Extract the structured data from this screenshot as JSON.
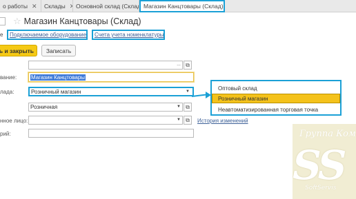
{
  "tabs": [
    {
      "label": "о работы"
    },
    {
      "label": "Склады"
    },
    {
      "label": "Основной склад (Склад)"
    },
    {
      "label": "Магазин Канцтовары (Склад)"
    }
  ],
  "header": {
    "title": "Магазин Канцтовары (Склад)"
  },
  "links": {
    "cut_label": "е",
    "equipment": "Подключаемое оборудование",
    "accounts": "Счета учета номенклатуры"
  },
  "toolbar": {
    "save_close": "ть и закрыть",
    "save": "Записать"
  },
  "form": {
    "name_label": "вание:",
    "name_value": "Магазин Канцтовары",
    "type_label": "лада:",
    "type_value": "Розничный магазин",
    "price_type_value": "Розничная",
    "responsible_label": "нное лицо:",
    "comment_label": "рий:",
    "history_link": "История изменений"
  },
  "dropdown": {
    "options": [
      {
        "label": "Оптовый склад"
      },
      {
        "label": "Розничный магазин"
      },
      {
        "label": "Неавтоматизированная торговая точка"
      }
    ],
    "selected_index": 1
  },
  "watermark": {
    "line1": "Группа Ком",
    "big": "SS",
    "line2": "SoftServis"
  },
  "colors": {
    "accent_highlight": "#1aa0d6",
    "primary_button": "#f5c915",
    "selection": "#f4c21b",
    "link": "#3b5f97"
  }
}
